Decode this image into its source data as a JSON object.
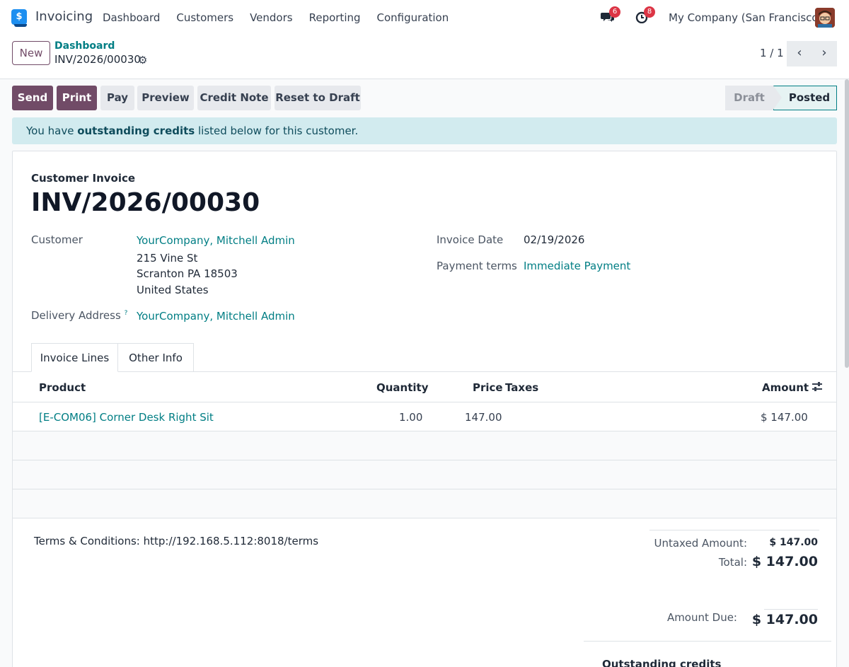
{
  "nav": {
    "app_name": "Invoicing",
    "menu": [
      "Dashboard",
      "Customers",
      "Vendors",
      "Reporting",
      "Configuration"
    ],
    "messages_count": "6",
    "activities_count": "8",
    "company": "My Company (San Francisco)"
  },
  "control": {
    "new_label": "New",
    "breadcrumb_parent": "Dashboard",
    "breadcrumb_current": "INV/2026/00030",
    "pager": "1 / 1"
  },
  "actions": {
    "send": "Send",
    "print": "Print",
    "pay": "Pay",
    "preview": "Preview",
    "credit_note": "Credit Note",
    "reset_to_draft": "Reset to Draft"
  },
  "status": {
    "draft": "Draft",
    "posted": "Posted"
  },
  "alert": {
    "prefix": "You have ",
    "emphasis": "outstanding credits",
    "suffix": " listed below for this customer."
  },
  "invoice": {
    "type_label": "Customer Invoice",
    "number": "INV/2026/00030",
    "customer_label": "Customer",
    "customer_name": "YourCompany, Mitchell Admin",
    "address_line1": "215 Vine St",
    "address_line2": "Scranton PA 18503",
    "address_line3": "United States",
    "delivery_label": "Delivery Address",
    "delivery_help": "?",
    "delivery_value": "YourCompany, Mitchell Admin",
    "invoice_date_label": "Invoice Date",
    "invoice_date": "02/19/2026",
    "payment_terms_label": "Payment terms",
    "payment_terms": "Immediate Payment"
  },
  "tabs": [
    "Invoice Lines",
    "Other Info"
  ],
  "lines": {
    "columns": {
      "product": "Product",
      "quantity": "Quantity",
      "price": "Price",
      "taxes": "Taxes",
      "amount": "Amount"
    },
    "rows": [
      {
        "product": "[E-COM06] Corner Desk Right Sit",
        "quantity": "1.00",
        "price": "147.00",
        "taxes": "",
        "amount": "$ 147.00"
      }
    ]
  },
  "footer": {
    "terms": "Terms & Conditions: http://192.168.5.112:8018/terms",
    "untaxed_label": "Untaxed Amount:",
    "untaxed_value": "$ 147.00",
    "total_label": "Total:",
    "total_value": "$ 147.00",
    "amount_due_label": "Amount Due:",
    "amount_due_value": "$ 147.00",
    "outstanding_credits": "Outstanding credits"
  },
  "colors": {
    "brand": "#714b67",
    "link": "#017e84",
    "alert_bg": "#d2ebef",
    "badge": "#dc3545"
  }
}
